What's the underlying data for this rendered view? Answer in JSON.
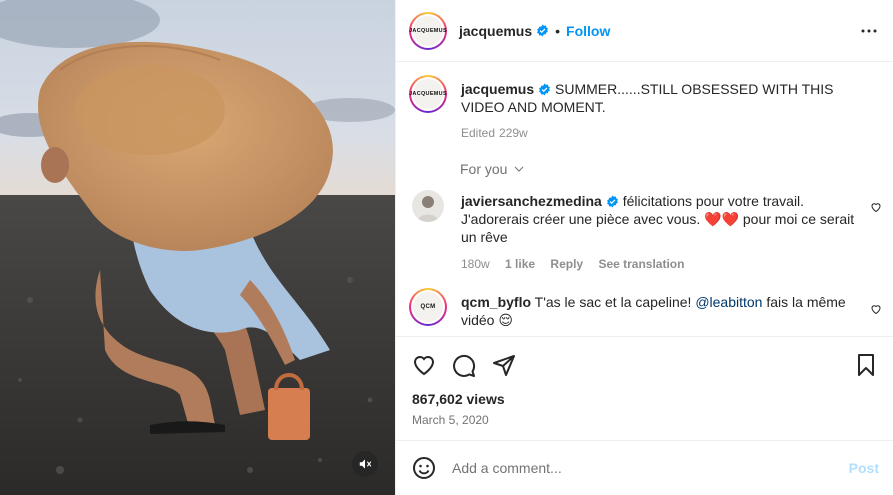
{
  "post": {
    "author": "jacquemus",
    "avatar_text": "JACQUEMUS",
    "follow_label": "Follow",
    "separator": "•",
    "caption_text": "SUMMER......STILL OBSESSED WITH THIS VIDEO AND MOMENT.",
    "caption_edited": "Edited",
    "caption_age": "229w",
    "views": "867,602 views",
    "date": "March 5, 2020"
  },
  "for_you_label": "For you",
  "comments": [
    {
      "username": "javiersanchezmedina",
      "text": "félicitations pour votre travail. J'adorerais créer une pièce avec vous. ❤️❤️ pour moi ce serait un rêve",
      "age": "180w",
      "likes": "1 like",
      "reply_label": "Reply",
      "translate_label": "See translation"
    },
    {
      "username": "qcm_byflo",
      "avatar_text": "QCM",
      "text_before": "T'as le sac et la capeline! ",
      "mention": "@leabitton",
      "text_after": " fais la même vidéo 😌"
    }
  ],
  "add_comment": {
    "placeholder": "Add a comment...",
    "post_label": "Post"
  },
  "icons": {
    "verified": "verified-badge-icon",
    "more": "more-options-icon",
    "like": "heart-icon",
    "comment": "comment-bubble-icon",
    "share": "send-icon",
    "save": "bookmark-icon",
    "emoji": "smiley-icon",
    "mute": "muted-speaker-icon",
    "chevron": "chevron-down-icon"
  },
  "colors": {
    "accent_blue": "#0095f6",
    "verified_blue": "#0095f6",
    "post_disabled": "#b2dffc",
    "heart_red": "#e0245e"
  }
}
